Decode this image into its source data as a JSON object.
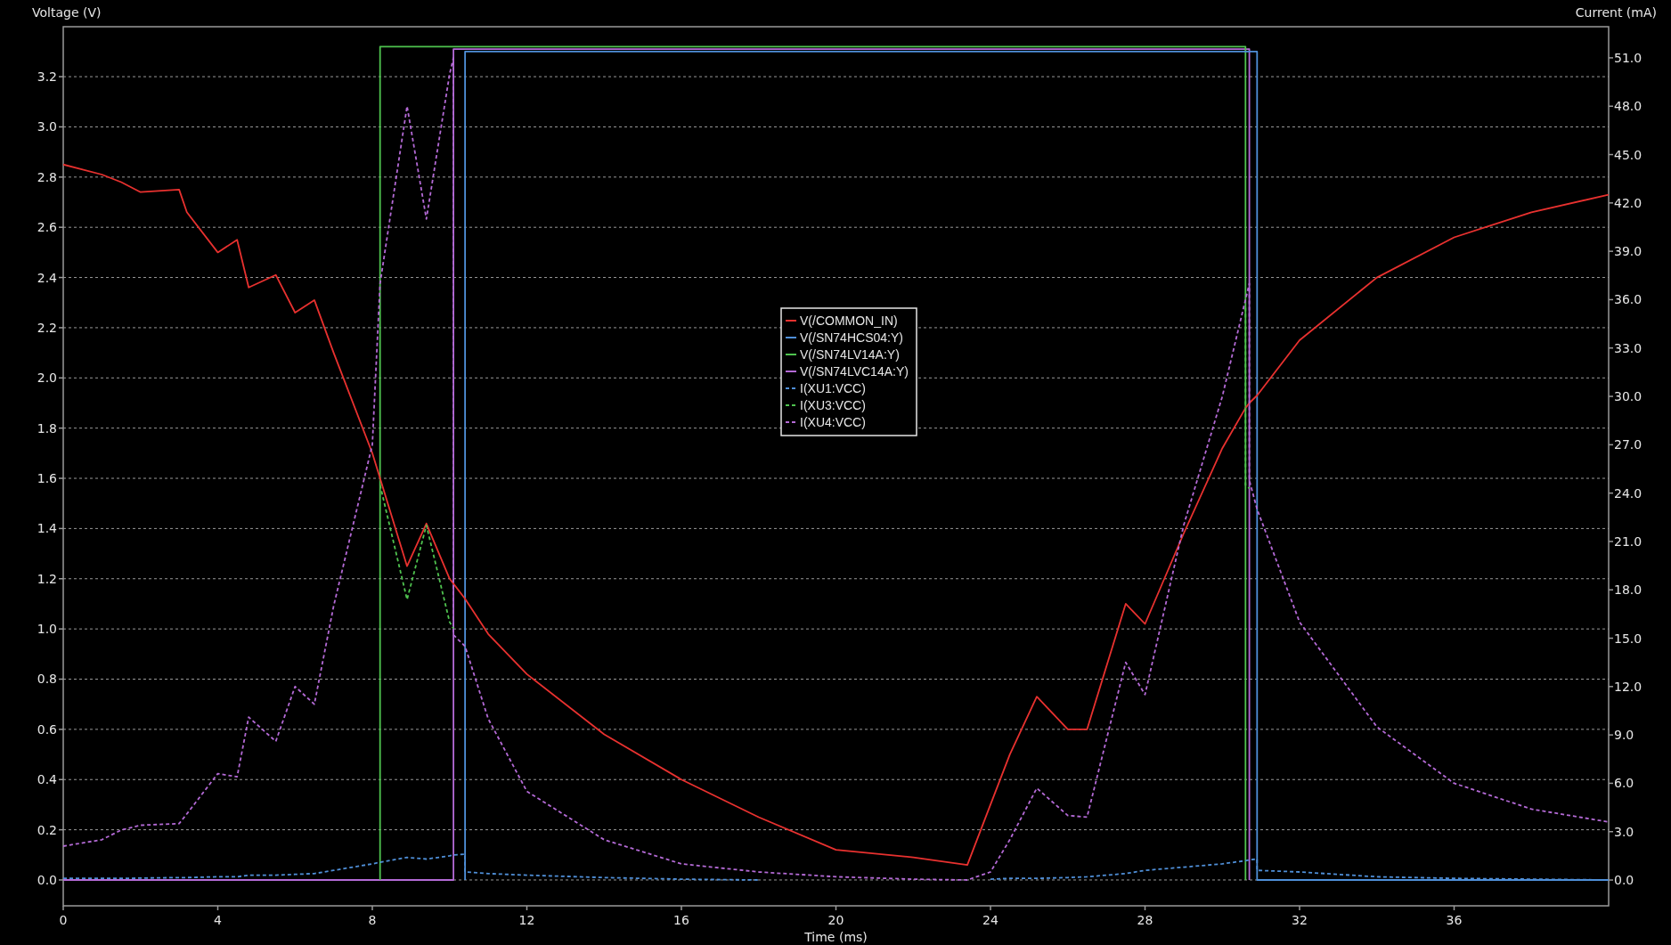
{
  "plot": {
    "chart_data": {
      "type": "line",
      "xlabel": "Time (ms)",
      "ylabel": "Voltage (V)",
      "y2label": "Current (mA)",
      "grid": true,
      "legend": true,
      "xlim": [
        0,
        40
      ],
      "ylim": [
        -0.103,
        3.399
      ],
      "y2lim": [
        -1.6,
        52.93
      ],
      "xticks": [
        0,
        4,
        8,
        12,
        16,
        20,
        24,
        28,
        32,
        36
      ],
      "yticks": [
        {
          "value": 0,
          "label": "0.0"
        },
        {
          "value": 0.2,
          "label": "0.2"
        },
        {
          "value": 0.4,
          "label": "0.4"
        },
        {
          "value": 0.6,
          "label": "0.6"
        },
        {
          "value": 0.8,
          "label": "0.8"
        },
        {
          "value": 1,
          "label": "1.0"
        },
        {
          "value": 1.2,
          "label": "1.2"
        },
        {
          "value": 1.4,
          "label": "1.4"
        },
        {
          "value": 1.6,
          "label": "1.6"
        },
        {
          "value": 1.8,
          "label": "1.8"
        },
        {
          "value": 2,
          "label": "2.0"
        },
        {
          "value": 2.2,
          "label": "2.2"
        },
        {
          "value": 2.4,
          "label": "2.4"
        },
        {
          "value": 2.6,
          "label": "2.6"
        },
        {
          "value": 2.8,
          "label": "2.8"
        },
        {
          "value": 3,
          "label": "3.0"
        },
        {
          "value": 3.2,
          "label": "3.2"
        }
      ],
      "y2ticks": [
        {
          "value": 0,
          "label": "0.0"
        },
        {
          "value": 3,
          "label": "3.0"
        },
        {
          "value": 6,
          "label": "6.0"
        },
        {
          "value": 9,
          "label": "9.0"
        },
        {
          "value": 12,
          "label": "12.0"
        },
        {
          "value": 15,
          "label": "15.0"
        },
        {
          "value": 18,
          "label": "18.0"
        },
        {
          "value": 21,
          "label": "21.0"
        },
        {
          "value": 24,
          "label": "24.0"
        },
        {
          "value": 27,
          "label": "27.0"
        },
        {
          "value": 30,
          "label": "30.0"
        },
        {
          "value": 33,
          "label": "33.0"
        },
        {
          "value": 36,
          "label": "36.0"
        },
        {
          "value": 39,
          "label": "39.0"
        },
        {
          "value": 42,
          "label": "42.0"
        },
        {
          "value": 45,
          "label": "45.0"
        },
        {
          "value": 48,
          "label": "48.0"
        },
        {
          "value": 51,
          "label": "51.0"
        }
      ],
      "x": [
        0,
        1,
        1.5,
        2,
        3,
        3.2,
        4,
        4.5,
        4.8,
        5.5,
        6,
        6.5,
        7,
        8,
        8.2,
        8.2,
        8.9,
        9.4,
        10,
        10.1,
        10.1,
        10.4,
        10.4,
        11,
        12,
        14,
        16,
        18,
        20,
        22,
        23.4,
        24,
        24.5,
        25.2,
        26,
        26.5,
        27.5,
        28,
        29,
        30,
        30.6,
        30.6,
        30.7,
        30.7,
        30.9,
        30.9,
        32,
        34,
        36,
        38,
        40
      ],
      "series": [
        {
          "name": "V(/COMMON_IN)",
          "color": "#e8312f",
          "axis": "y",
          "line_style": "solid",
          "values": [
            2.85,
            2.81,
            2.78,
            2.74,
            2.75,
            2.66,
            2.5,
            2.55,
            2.36,
            2.41,
            2.26,
            2.31,
            2.1,
            1.7,
            1.6,
            1.6,
            1.25,
            1.42,
            1.2,
            1.18,
            1.18,
            1.12,
            1.12,
            0.98,
            0.82,
            0.58,
            0.4,
            0.25,
            0.12,
            0.09,
            0.06,
            0.3,
            0.5,
            0.73,
            0.6,
            0.6,
            1.1,
            1.02,
            1.38,
            1.72,
            1.88,
            1.88,
            1.9,
            1.9,
            1.93,
            1.93,
            2.15,
            2.4,
            2.56,
            2.66,
            2.73
          ]
        },
        {
          "name": "V(/SN74HCS04:Y)",
          "color": "#4f8fd8",
          "axis": "y",
          "line_style": "solid",
          "values": [
            null,
            null,
            null,
            null,
            null,
            null,
            null,
            null,
            null,
            null,
            null,
            null,
            null,
            null,
            null,
            null,
            null,
            null,
            null,
            null,
            null,
            0,
            3.3,
            3.3,
            3.3,
            3.3,
            3.3,
            3.3,
            3.3,
            3.3,
            3.3,
            3.3,
            3.3,
            3.3,
            3.3,
            3.3,
            3.3,
            3.3,
            3.3,
            3.3,
            3.3,
            3.3,
            3.3,
            3.3,
            3.3,
            0,
            0,
            0,
            0,
            0,
            0
          ]
        },
        {
          "name": "V(/SN74LV14A:Y)",
          "color": "#4fc34f",
          "axis": "y",
          "line_style": "solid",
          "values": [
            null,
            null,
            null,
            null,
            null,
            null,
            null,
            null,
            null,
            null,
            null,
            null,
            null,
            null,
            0,
            3.32,
            3.32,
            3.32,
            3.32,
            3.32,
            3.32,
            3.32,
            3.32,
            3.32,
            3.32,
            3.32,
            3.32,
            3.32,
            3.32,
            3.32,
            3.32,
            3.32,
            3.32,
            3.32,
            3.32,
            3.32,
            3.32,
            3.32,
            3.32,
            3.32,
            3.32,
            0,
            null,
            null,
            null,
            null,
            null,
            null,
            null,
            null,
            null
          ]
        },
        {
          "name": "V(/SN74LVC14A:Y)",
          "color": "#b46ad6",
          "axis": "y",
          "line_style": "solid",
          "values": [
            0,
            0,
            0,
            0,
            0,
            0,
            0,
            0,
            0,
            0,
            0,
            0,
            0,
            0,
            0,
            0,
            0,
            0,
            0,
            0,
            3.31,
            3.31,
            3.31,
            3.31,
            3.31,
            3.31,
            3.31,
            3.31,
            3.31,
            3.31,
            3.31,
            3.31,
            3.31,
            3.31,
            3.31,
            3.31,
            3.31,
            3.31,
            3.31,
            3.31,
            3.31,
            3.31,
            3.31,
            0,
            null,
            null,
            null,
            null,
            null,
            null,
            null
          ]
        },
        {
          "name": "I(XU1:VCC)",
          "color": "#4f8fd8",
          "axis": "y2",
          "line_style": "dashed",
          "values": [
            0.1,
            0.1,
            0.1,
            0.12,
            0.15,
            0.15,
            0.2,
            0.2,
            0.3,
            0.3,
            0.35,
            0.4,
            0.6,
            1.0,
            1.1,
            1.1,
            1.4,
            1.3,
            1.5,
            1.55,
            1.55,
            1.6,
            0.5,
            0.4,
            0.3,
            0.15,
            0.05,
            0,
            null,
            null,
            null,
            0.05,
            0.1,
            0.1,
            0.15,
            0.2,
            0.4,
            0.6,
            0.8,
            1.0,
            1.2,
            1.2,
            1.25,
            1.25,
            1.3,
            0.6,
            0.5,
            0.2,
            0.1,
            0.05,
            0
          ]
        },
        {
          "name": "I(XU3:VCC)",
          "color": "#4fc34f",
          "axis": "y2",
          "line_style": "dashed",
          "values": [
            null,
            null,
            null,
            null,
            null,
            null,
            null,
            null,
            null,
            null,
            null,
            null,
            null,
            null,
            null,
            24.5,
            17.4,
            22,
            16,
            15.6,
            null,
            null,
            null,
            null,
            null,
            null,
            null,
            null,
            null,
            null,
            null,
            null,
            null,
            null,
            null,
            null,
            null,
            null,
            null,
            null,
            35.5,
            24.5,
            24.3,
            null,
            null,
            null,
            null,
            null,
            null,
            null,
            null
          ]
        },
        {
          "name": "I(XU4:VCC)",
          "color": "#b46ad6",
          "axis": "y2",
          "line_style": "dashed",
          "values": [
            2.1,
            2.5,
            3.1,
            3.4,
            3.5,
            4.1,
            6.6,
            6.4,
            10.1,
            8.6,
            12,
            10.9,
            17,
            27,
            37,
            37,
            48,
            41,
            50,
            51,
            15.2,
            14.5,
            14.5,
            10,
            5.5,
            2.5,
            1.0,
            0.5,
            0.2,
            0.05,
            0,
            0.5,
            2.5,
            5.7,
            4,
            3.9,
            13.5,
            11.5,
            22,
            30,
            36,
            36,
            37,
            24.8,
            23,
            23,
            16,
            9.5,
            6,
            4.4,
            3.6
          ]
        }
      ]
    }
  }
}
